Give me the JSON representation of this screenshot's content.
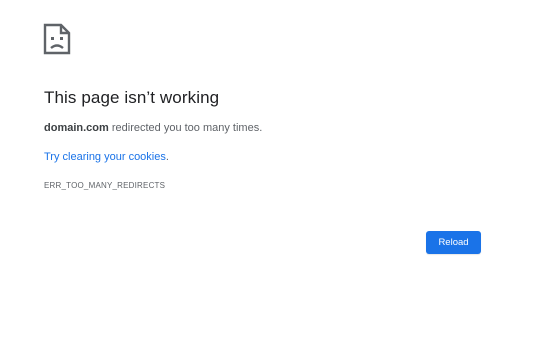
{
  "icon": "sad-page-icon",
  "title": "This page isn’t working",
  "message": {
    "domain": "domain.com",
    "text": " redirected you too many times."
  },
  "suggestion": {
    "link_text": "Try clearing your cookies",
    "suffix": "."
  },
  "error_code": "ERR_TOO_MANY_REDIRECTS",
  "reload_button": {
    "label": "Reload"
  },
  "colors": {
    "accent": "#1a73e8",
    "title": "#202124",
    "body_text": "#5f6368"
  }
}
